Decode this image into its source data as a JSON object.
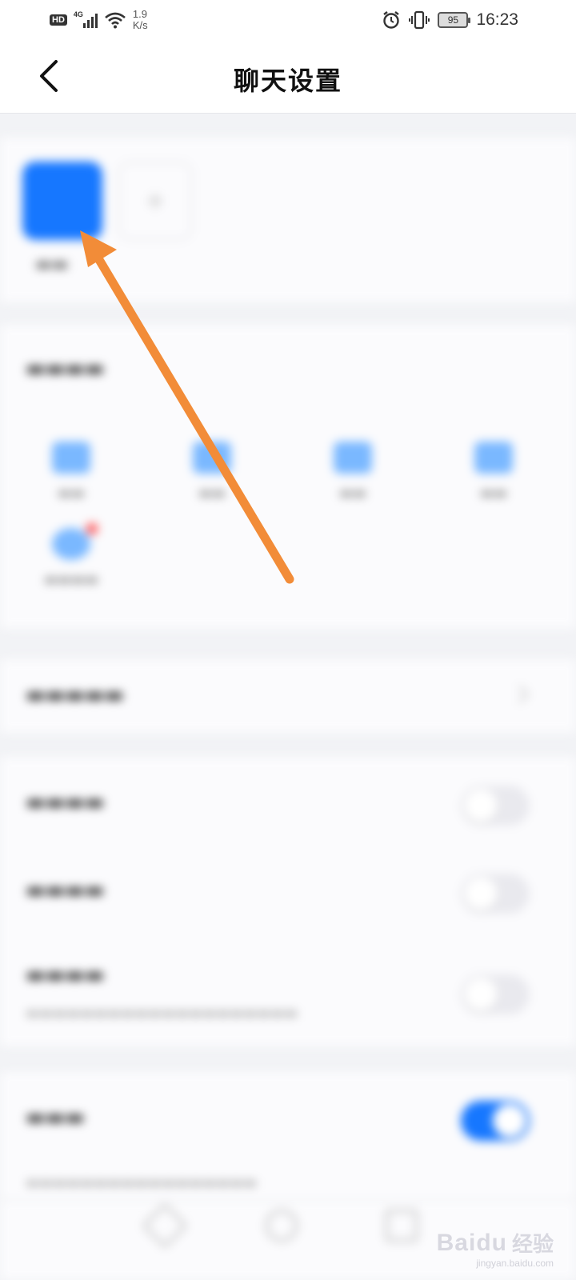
{
  "status_bar": {
    "hd": "HD",
    "network": "4G",
    "speed_value": "1.9",
    "speed_unit": "K/s",
    "battery": "95",
    "time": "16:23"
  },
  "header": {
    "title": "聊天设置"
  },
  "colors": {
    "accent": "#1677ff",
    "arrow": "#f28c38"
  },
  "watermark": {
    "brand": "Baidu",
    "sub": "经验",
    "url": "jingyan.baidu.com"
  }
}
